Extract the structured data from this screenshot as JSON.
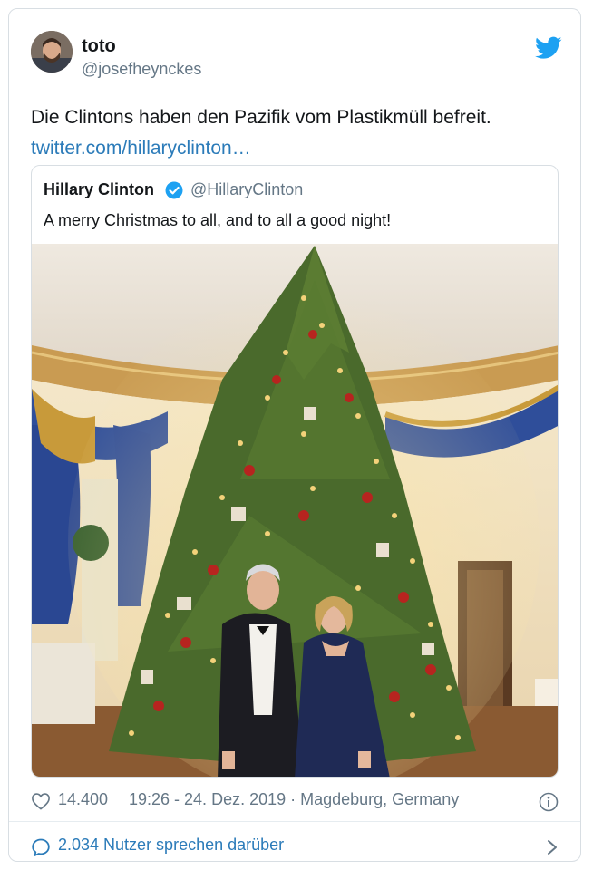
{
  "author": {
    "name": "toto",
    "handle": "@josefheynckes"
  },
  "tweet": {
    "text": "Die Clintons haben den Pazifik vom Plastikmüll befreit.",
    "link": "twitter.com/hillaryclinton…"
  },
  "quoted": {
    "name": "Hillary Clinton",
    "handle": "@HillaryClinton",
    "text": "A merry Christmas to all, and to all a good night!"
  },
  "meta": {
    "likes": "14.400",
    "timestamp": "19:26 - 24. Dez. 2019 · Magdeburg, Germany"
  },
  "conversation": {
    "label": "2.034 Nutzer sprechen darüber"
  },
  "colors": {
    "accent": "#1da1f2",
    "link": "#2b7bb9",
    "muted": "#657786",
    "border": "#d8dee3"
  },
  "icons": [
    "twitter-bird-icon",
    "verified-badge-icon",
    "heart-icon",
    "info-icon",
    "speech-bubble-icon",
    "chevron-right-icon"
  ]
}
